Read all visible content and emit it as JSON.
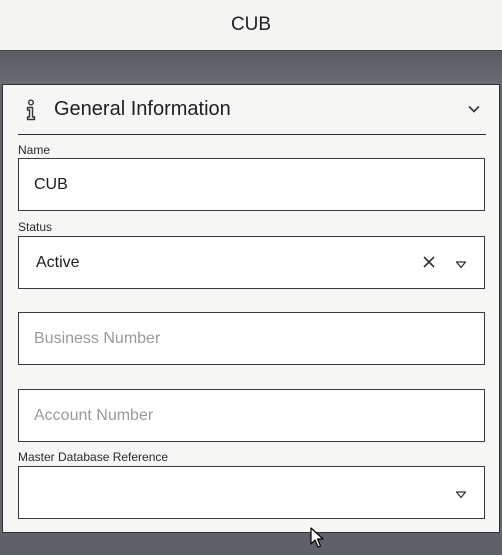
{
  "window": {
    "title": "CUB"
  },
  "section": {
    "title": "General Information",
    "info_icon": "info-icon",
    "collapse_icon": "chevron-down-icon"
  },
  "fields": {
    "name": {
      "label": "Name",
      "value": "CUB"
    },
    "status": {
      "label": "Status",
      "value": "Active"
    },
    "business_number": {
      "placeholder": "Business Number",
      "value": ""
    },
    "account_number": {
      "placeholder": "Account Number",
      "value": ""
    },
    "master_db_ref": {
      "label": "Master Database Reference",
      "value": ""
    }
  },
  "colors": {
    "titlebar_bg": "#f5f5f3",
    "backdrop": "#62656c",
    "panel_bg": "#f6f6f4",
    "field_border": "#3a3a3a",
    "placeholder": "#9a9a9a"
  }
}
